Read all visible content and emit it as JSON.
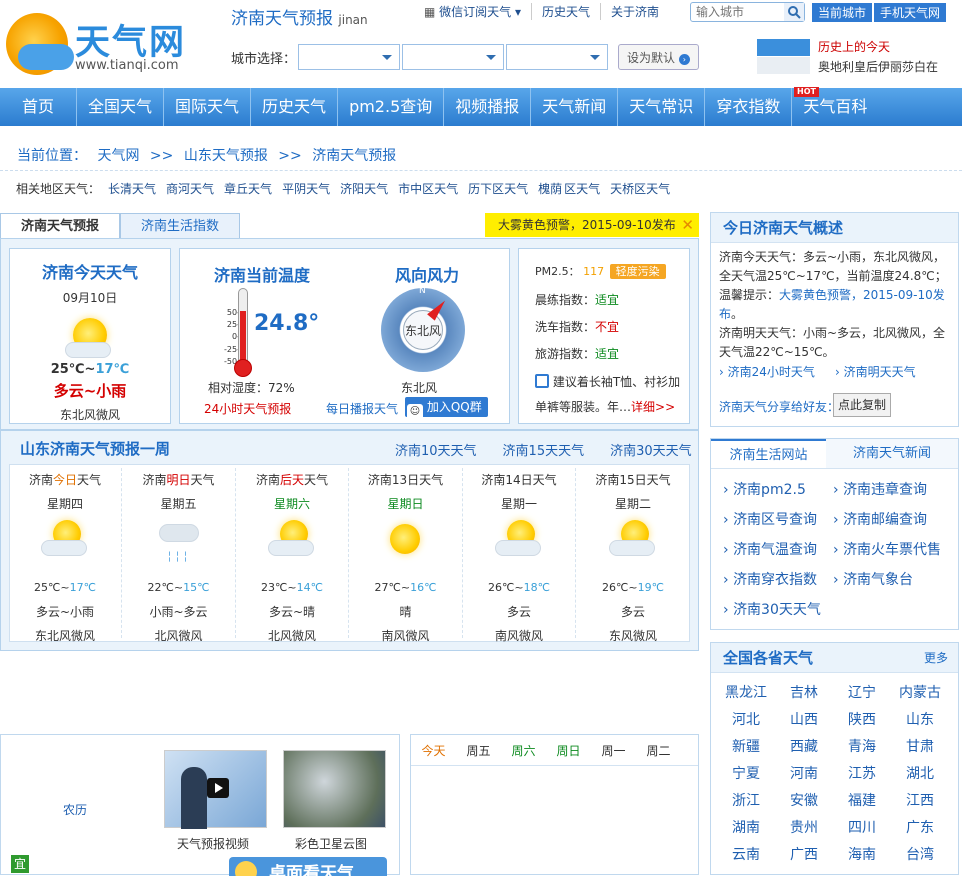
{
  "logo": {
    "text": "天气网",
    "url": "www.tianqi.com"
  },
  "header": {
    "title": "济南天气预报",
    "title_en": "jinan",
    "links": [
      "微信订阅天气",
      "历史天气",
      "关于济南"
    ],
    "search_placeholder": "输入城市",
    "links_right": [
      "当前城市",
      "手机天气网"
    ],
    "city_select_label": "城市选择：",
    "set_default": "设为默认",
    "history_title": "历史上的今天",
    "history_text": "奥地利皇后伊丽莎白在"
  },
  "nav": {
    "items": [
      "首页",
      "全国天气",
      "国际天气",
      "历史天气",
      "pm2.5查询",
      "视频播报",
      "天气新闻",
      "天气常识",
      "穿衣指数",
      "天气百科"
    ],
    "hot_badge": "HOT"
  },
  "breadcrumb": {
    "prefix": "当前位置：",
    "items": [
      "天气网",
      "山东天气预报",
      "济南天气预报"
    ],
    "sep": ">>"
  },
  "related": {
    "label": "相关地区天气：",
    "items": [
      "长清天气",
      "商河天气",
      "章丘天气",
      "平阴天气",
      "济阳天气",
      "市中区天气",
      "历下区天气",
      "槐荫",
      "区天气",
      "天桥区天气"
    ]
  },
  "tabs": [
    "济南天气预报",
    "济南生活指数"
  ],
  "alert": {
    "text": "大雾黄色预警，2015-09-10发布",
    "close": "✕"
  },
  "today": {
    "title": "济南今天天气",
    "date": "09月10日",
    "temp_high": "25℃",
    "temp_sep": "~",
    "temp_low": "17℃",
    "condition": "多云~小雨",
    "wind": "东北风微风"
  },
  "current": {
    "title": "济南当前温度",
    "temp": "24.8°",
    "scale": [
      "50-",
      "25-",
      "0-",
      "-25-",
      "-50-"
    ],
    "humidity": "相对湿度：72%",
    "forecast_link": "24小时天气预报"
  },
  "wind": {
    "title": "风向风力",
    "compass_label": "东北风",
    "compass_n": "N",
    "direction": "东北风",
    "daily_link": "每日播报天气",
    "qq_button": "加入QQ群"
  },
  "indices": {
    "pm_label": "PM2.5：",
    "pm_value": "117",
    "pm_level": "轻度污染",
    "rows": [
      {
        "label": "晨练指数：",
        "value": "适宜"
      },
      {
        "label": "洗车指数：",
        "value": "不宜"
      },
      {
        "label": "旅游指数：",
        "value": "适宜"
      }
    ],
    "tip": "建议着长袖T恤、衬衫加单裤等服装。年…",
    "detail": "详细>>"
  },
  "week": {
    "title": "山东济南天气预报一周",
    "links": [
      "济南10天天气",
      "济南15天天气",
      "济南30天天气"
    ],
    "days": [
      {
        "city": "济南",
        "hl": "今日",
        "suffix": "天气",
        "weekday": "星期四",
        "wcolor": "#333",
        "icon": "sun-cloud",
        "high": "25℃",
        "low": "17℃",
        "cond": "多云~小雨",
        "wind": "东北风微风"
      },
      {
        "city": "济南",
        "hl": "明日",
        "suffix": "天气",
        "weekday": "星期五",
        "wcolor": "#333",
        "icon": "rain",
        "high": "22℃",
        "low": "15℃",
        "cond": "小雨~多云",
        "wind": "北风微风"
      },
      {
        "city": "济南",
        "hl": "后天",
        "suffix": "天气",
        "weekday": "星期六",
        "wcolor": "#0c8a1f",
        "icon": "sun-cloud",
        "high": "23℃",
        "low": "14℃",
        "cond": "多云~晴",
        "wind": "北风微风"
      },
      {
        "city": "济南",
        "hl": "",
        "suffix": "13日天气",
        "weekday": "星期日",
        "wcolor": "#0c8a1f",
        "icon": "sun",
        "high": "27℃",
        "low": "16℃",
        "cond": "晴",
        "wind": "南风微风"
      },
      {
        "city": "济南",
        "hl": "",
        "suffix": "14日天气",
        "weekday": "星期一",
        "wcolor": "#333",
        "icon": "sun-cloud",
        "high": "26℃",
        "low": "18℃",
        "cond": "多云",
        "wind": "南风微风"
      },
      {
        "city": "济南",
        "hl": "",
        "suffix": "15日天气",
        "weekday": "星期二",
        "wcolor": "#333",
        "icon": "sun-cloud",
        "high": "26℃",
        "low": "19℃",
        "cond": "多云",
        "wind": "东风微风"
      }
    ]
  },
  "overview": {
    "title": "今日济南天气概述",
    "p1": "济南今天天气：多云~小雨，东北风微风，全天气温25℃~17℃，当前温度24.8℃；温馨提示：",
    "p1_link": "大雾黄色预警，2015-09-10发布",
    "p1_end": "。",
    "p2": "济南明天天气：小雨~多云，北风微风，全天气温22℃~15℃。",
    "links": [
      "济南24小时天气",
      "济南明天天气"
    ],
    "share": "济南天气分享给好友：",
    "copy": "点此复制"
  },
  "life": {
    "tabs": [
      "济南生活网站",
      "济南天气新闻"
    ],
    "links": [
      "济南pm2.5",
      "济南违章查询",
      "济南区号查询",
      "济南邮编查询",
      "济南气温查询",
      "济南火车票代售",
      "济南穿衣指数",
      "济南气象台",
      "济南30天天气"
    ]
  },
  "provinces": {
    "title": "全国各省天气",
    "more": "更多",
    "items": [
      "黑龙江",
      "吉林",
      "辽宁",
      "内蒙古",
      "河北",
      "山西",
      "陕西",
      "山东",
      "新疆",
      "西藏",
      "青海",
      "甘肃",
      "宁夏",
      "河南",
      "江苏",
      "湖北",
      "浙江",
      "安徽",
      "福建",
      "江西",
      "湖南",
      "贵州",
      "四川",
      "广东",
      "云南",
      "广西",
      "海南",
      "台湾"
    ]
  },
  "bottom": {
    "lunar": "农历",
    "yi": "宜",
    "video_label": "天气预报视频",
    "satellite_label": "彩色卫星云图",
    "desk_label": "桌面看天气",
    "day_tabs": [
      "今天",
      "周五",
      "周六",
      "周日",
      "周一",
      "周二"
    ]
  }
}
